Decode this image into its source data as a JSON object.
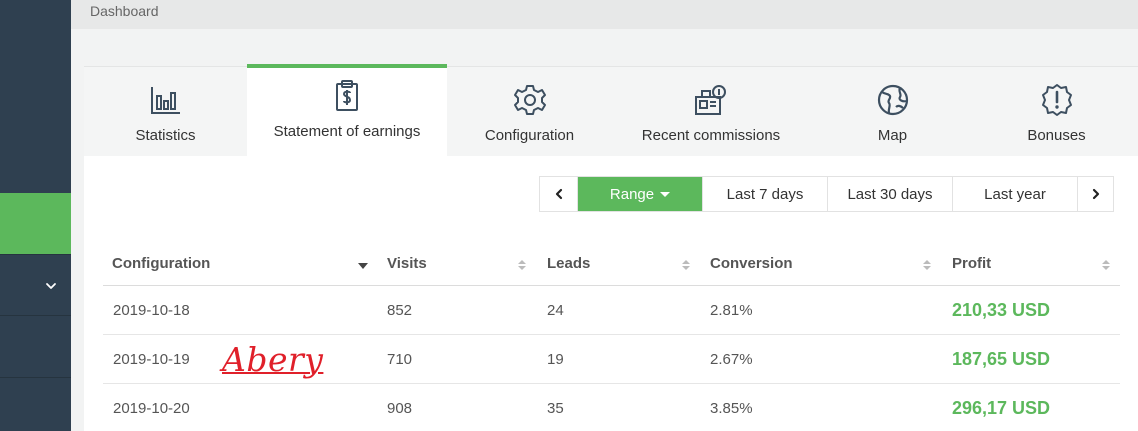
{
  "breadcrumb": "Dashboard",
  "tabs": [
    {
      "label": "Statistics",
      "icon": "bar-chart-icon"
    },
    {
      "label": "Statement of earnings",
      "icon": "clipboard-dollar-icon",
      "active": true
    },
    {
      "label": "Configuration",
      "icon": "gear-icon"
    },
    {
      "label": "Recent commissions",
      "icon": "cash-register-icon"
    },
    {
      "label": "Map",
      "icon": "globe-icon"
    },
    {
      "label": "Bonuses",
      "icon": "badge-alert-icon"
    }
  ],
  "range": {
    "prev_icon": "chevron-left-icon",
    "next_icon": "chevron-right-icon",
    "selected": "Range",
    "options": [
      "Last 7 days",
      "Last 30 days",
      "Last year"
    ]
  },
  "table": {
    "columns": [
      "Configuration",
      "Visits",
      "Leads",
      "Conversion",
      "Profit"
    ],
    "rows": [
      {
        "date": "2019-10-18",
        "visits": "852",
        "leads": "24",
        "conversion": "2.81%",
        "profit": "210,33 USD"
      },
      {
        "date": "2019-10-19",
        "visits": "710",
        "leads": "19",
        "conversion": "2.67%",
        "profit": "187,65 USD"
      },
      {
        "date": "2019-10-20",
        "visits": "908",
        "leads": "35",
        "conversion": "3.85%",
        "profit": "296,17 USD"
      }
    ]
  },
  "signature": "Abery",
  "colors": {
    "accent": "#5cb85c",
    "sidebar": "#2f4050",
    "signature": "#e0202a"
  }
}
